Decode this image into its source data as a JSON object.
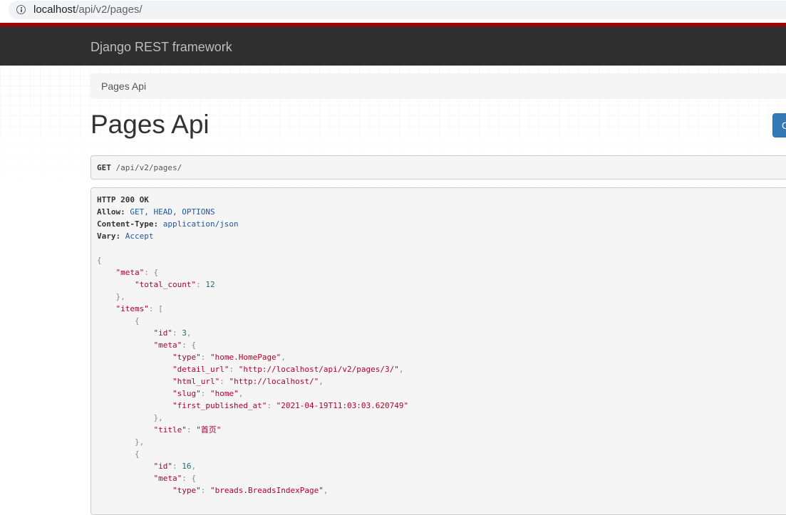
{
  "browser": {
    "url_host": "localhost",
    "url_path": "/api/v2/pages/"
  },
  "navbar": {
    "brand": "Django REST framework"
  },
  "breadcrumb": {
    "item": "Pages Api"
  },
  "page": {
    "title": "Pages Api",
    "options_button_label": "O"
  },
  "request": {
    "method": "GET",
    "path": "/api/v2/pages/"
  },
  "response": {
    "status": "HTTP 200 OK",
    "headers": [
      {
        "key": "Allow:",
        "value": "GET, HEAD, OPTIONS"
      },
      {
        "key": "Content-Type:",
        "value": "application/json"
      },
      {
        "key": "Vary:",
        "value": "Accept"
      }
    ],
    "body": {
      "meta_key": "\"meta\"",
      "total_count_key": "\"total_count\"",
      "total_count_value": "12",
      "items_key": "\"items\"",
      "items": [
        {
          "id": "3",
          "type": "\"home.HomePage\"",
          "detail_url": "\"http://localhost/api/v2/pages/3/\"",
          "html_url": "\"http://localhost/\"",
          "slug": "\"home\"",
          "first_published_at": "\"2021-04-19T11:03:03.620749\"",
          "title": "\"首页\""
        },
        {
          "id": "16",
          "type": "\"breads.BreadsIndexPage\""
        }
      ]
    }
  },
  "colors": {
    "navbar_bg": "#2f2f2f",
    "navbar_accent": "#a30000",
    "brand_text": "#bdbdbd",
    "string": "#b30028",
    "number": "#1a6d6d",
    "button": "#337ab7"
  }
}
